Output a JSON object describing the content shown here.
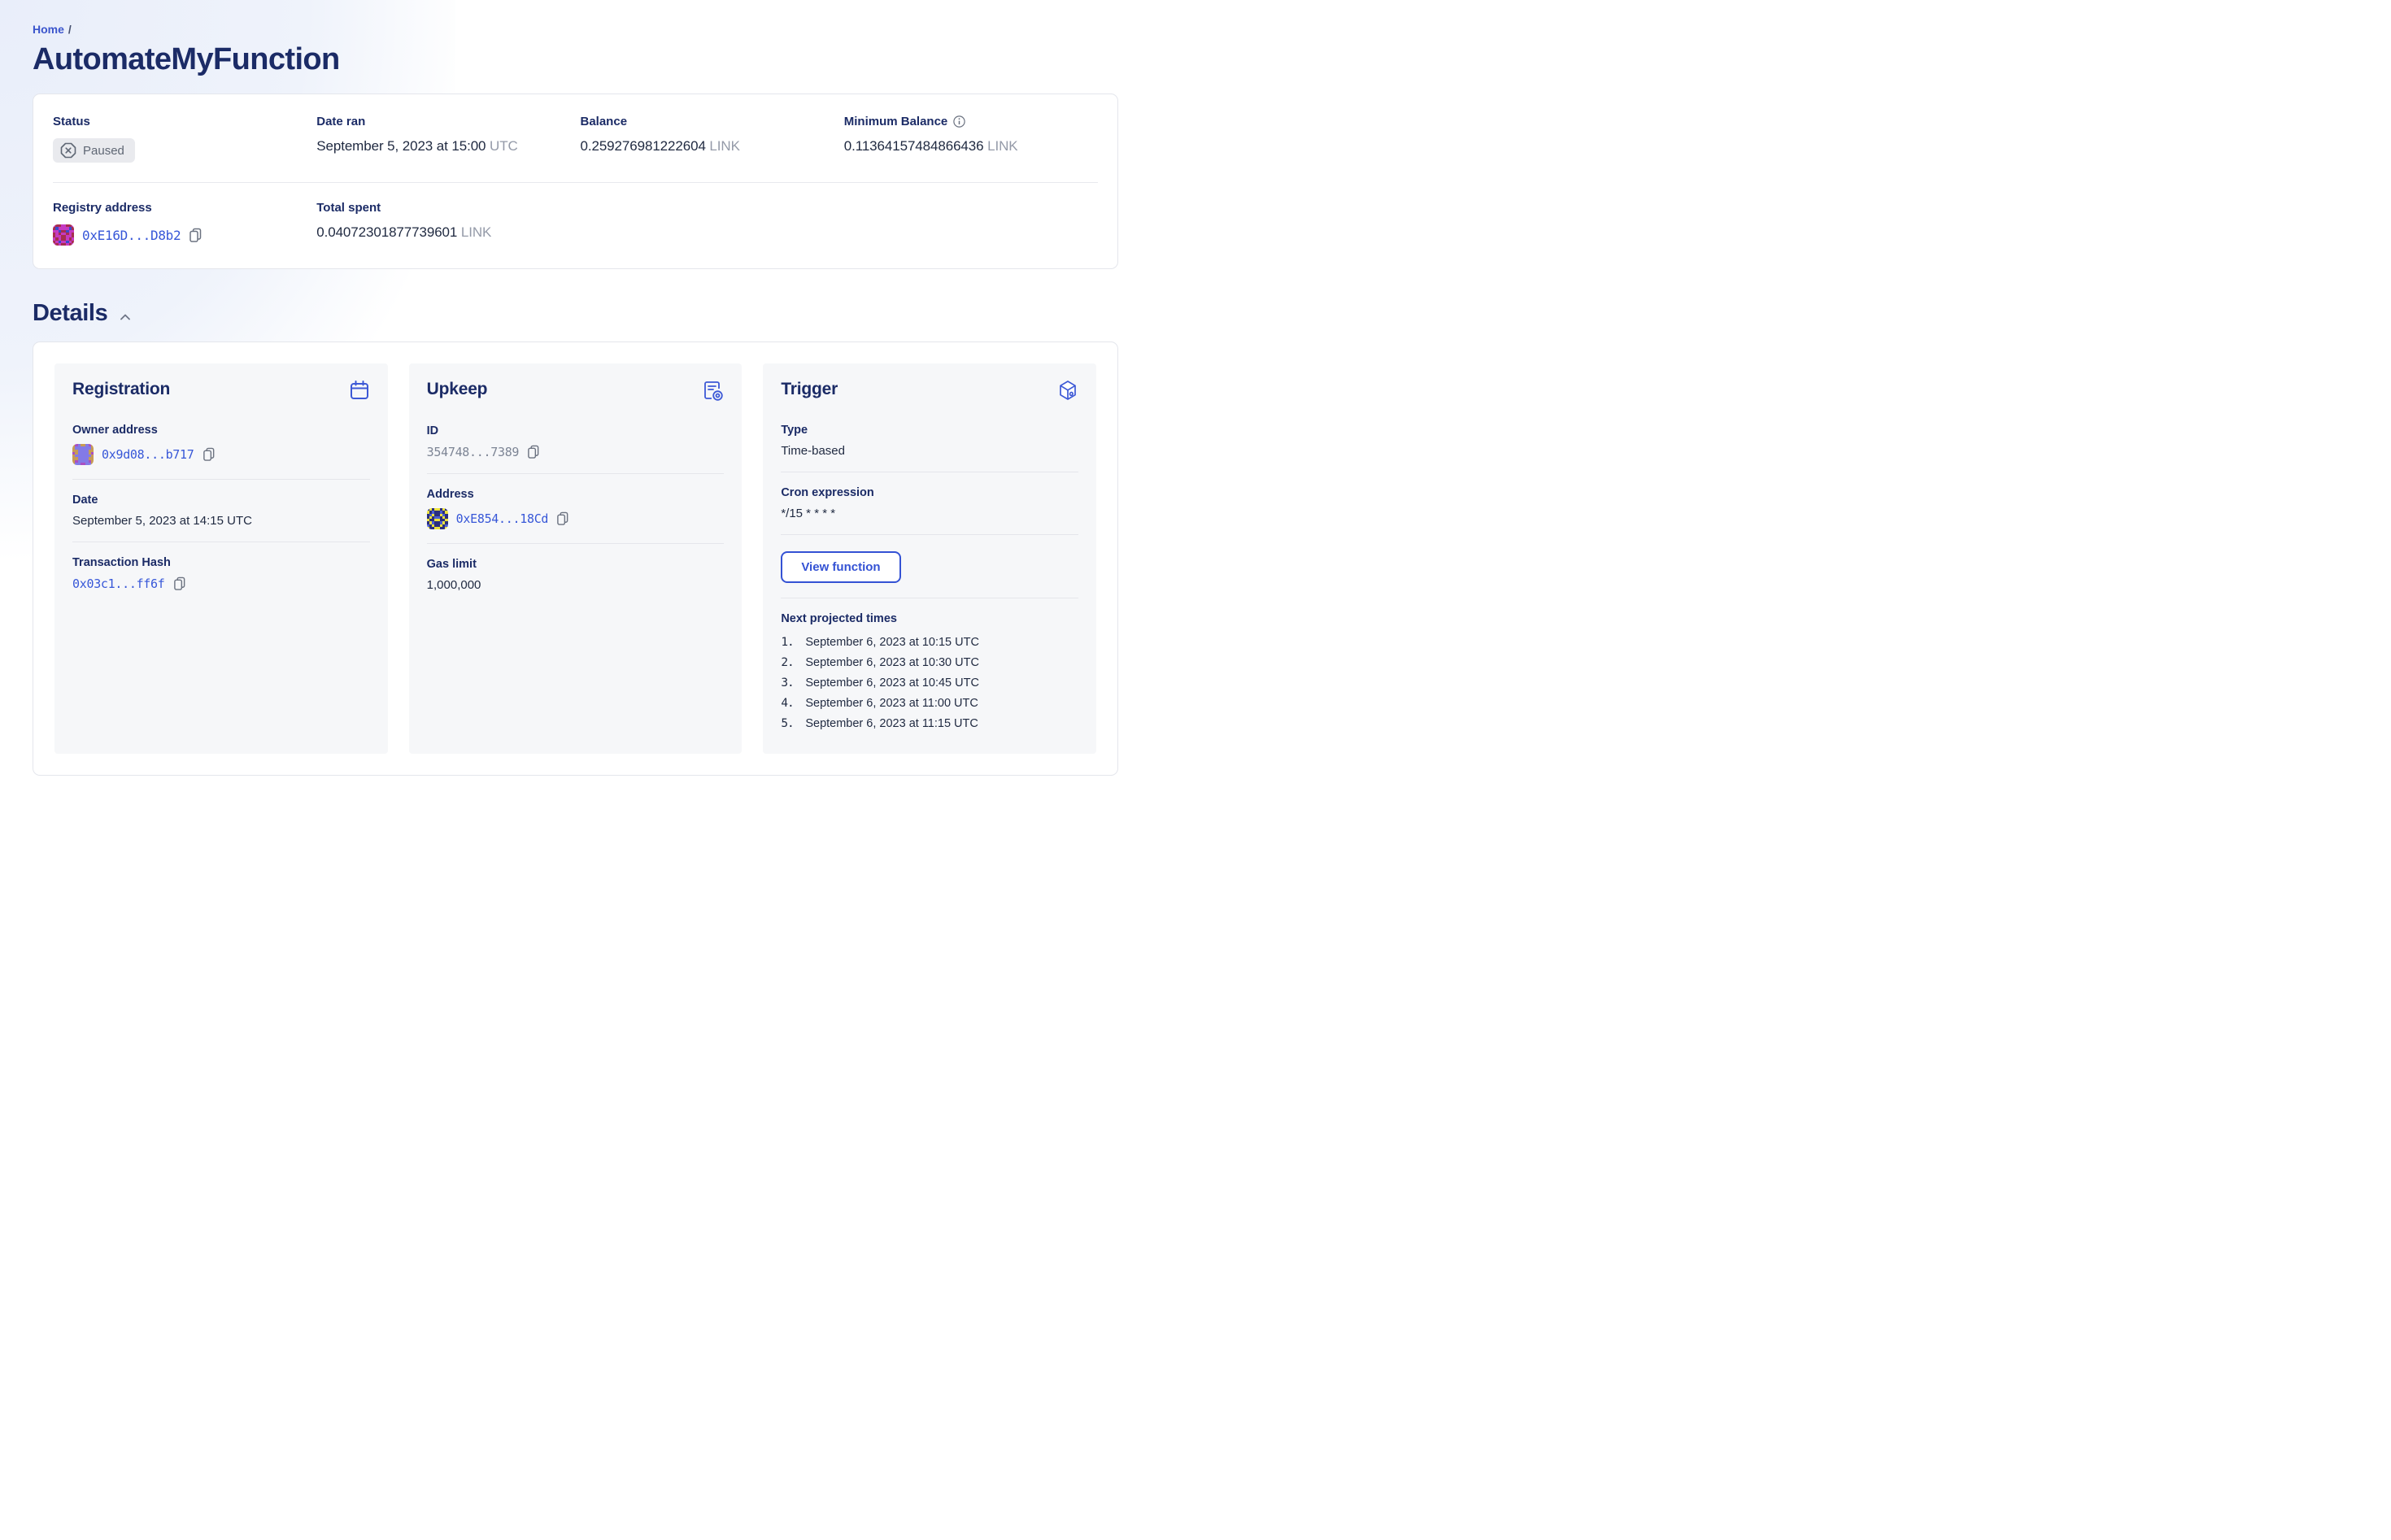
{
  "breadcrumb": {
    "home": "Home",
    "separator": "/"
  },
  "page_title": "AutomateMyFunction",
  "overview": {
    "status": {
      "label": "Status",
      "value": "Paused"
    },
    "date_ran": {
      "label": "Date ran",
      "value": "September 5, 2023 at 15:00",
      "suffix": "UTC"
    },
    "balance": {
      "label": "Balance",
      "value": "0.259276981222604",
      "suffix": "LINK"
    },
    "min_balance": {
      "label": "Minimum Balance",
      "value": "0.11364157484866436",
      "suffix": "LINK"
    },
    "registry": {
      "label": "Registry address",
      "value": "0xE16D...D8b2"
    },
    "total_spent": {
      "label": "Total spent",
      "value": "0.04072301877739601",
      "suffix": "LINK"
    }
  },
  "details": {
    "heading": "Details",
    "registration": {
      "title": "Registration",
      "owner": {
        "label": "Owner address",
        "value": "0x9d08...b717"
      },
      "date": {
        "label": "Date",
        "value": "September 5, 2023 at 14:15 UTC"
      },
      "tx": {
        "label": "Transaction Hash",
        "value": "0x03c1...ff6f"
      }
    },
    "upkeep": {
      "title": "Upkeep",
      "id": {
        "label": "ID",
        "value": "354748...7389"
      },
      "address": {
        "label": "Address",
        "value": "0xE854...18Cd"
      },
      "gas": {
        "label": "Gas limit",
        "value": "1,000,000"
      }
    },
    "trigger": {
      "title": "Trigger",
      "type": {
        "label": "Type",
        "value": "Time-based"
      },
      "cron": {
        "label": "Cron expression",
        "value": "*/15 * * * *"
      },
      "view_function_label": "View function",
      "projected": {
        "label": "Next projected times",
        "items": [
          {
            "num": "1.",
            "text": "September 6, 2023 at 10:15 UTC"
          },
          {
            "num": "2.",
            "text": "September 6, 2023 at 10:30 UTC"
          },
          {
            "num": "3.",
            "text": "September 6, 2023 at 10:45 UTC"
          },
          {
            "num": "4.",
            "text": "September 6, 2023 at 11:00 UTC"
          },
          {
            "num": "5.",
            "text": "September 6, 2023 at 11:15 UTC"
          }
        ]
      }
    }
  },
  "identicons": {
    "registry": {
      "palette": [
        "#c53ac1",
        "#a72e4e",
        "#3c49cb"
      ],
      "grid": [
        [
          0,
          1,
          1,
          0,
          0,
          1,
          1,
          0
        ],
        [
          1,
          2,
          0,
          0,
          0,
          0,
          2,
          1
        ],
        [
          0,
          0,
          2,
          1,
          1,
          2,
          0,
          0
        ],
        [
          1,
          0,
          1,
          0,
          0,
          1,
          0,
          1
        ],
        [
          1,
          0,
          0,
          1,
          1,
          0,
          0,
          1
        ],
        [
          0,
          1,
          0,
          1,
          1,
          0,
          1,
          0
        ],
        [
          1,
          0,
          2,
          0,
          0,
          2,
          0,
          1
        ],
        [
          0,
          1,
          0,
          1,
          1,
          0,
          1,
          0
        ]
      ]
    },
    "owner": {
      "palette": [
        "#c89b54",
        "#837ae6",
        "#a94fc2"
      ],
      "grid": [
        [
          0,
          2,
          1,
          0,
          0,
          1,
          2,
          0
        ],
        [
          0,
          1,
          1,
          1,
          1,
          1,
          1,
          0
        ],
        [
          0,
          0,
          1,
          1,
          1,
          1,
          0,
          0
        ],
        [
          2,
          0,
          1,
          1,
          1,
          1,
          0,
          2
        ],
        [
          0,
          1,
          1,
          1,
          1,
          1,
          1,
          0
        ],
        [
          0,
          0,
          1,
          1,
          1,
          1,
          0,
          0
        ],
        [
          0,
          2,
          1,
          1,
          1,
          1,
          2,
          0
        ],
        [
          0,
          1,
          1,
          2,
          2,
          1,
          1,
          0
        ]
      ]
    },
    "upkeep": {
      "palette": [
        "#ece23e",
        "#2b2f7e",
        "#4d5fd3"
      ],
      "grid": [
        [
          1,
          0,
          1,
          0,
          0,
          1,
          0,
          1
        ],
        [
          0,
          1,
          2,
          1,
          1,
          2,
          1,
          0
        ],
        [
          1,
          2,
          0,
          1,
          1,
          0,
          2,
          1
        ],
        [
          1,
          0,
          1,
          2,
          2,
          1,
          0,
          1
        ],
        [
          0,
          1,
          1,
          0,
          0,
          1,
          1,
          0
        ],
        [
          1,
          0,
          2,
          1,
          1,
          2,
          0,
          1
        ],
        [
          2,
          1,
          0,
          1,
          1,
          0,
          1,
          2
        ],
        [
          0,
          1,
          1,
          0,
          0,
          1,
          1,
          0
        ]
      ]
    }
  },
  "colors": {
    "accent_blue": "#3757d8",
    "heading_navy": "#1b2b66",
    "value_dark": "#1f2940",
    "muted_gray": "#949aa8",
    "badge_bg": "#e9eaee",
    "badge_text": "#5f6774",
    "card_bg": "#f6f7f9",
    "border": "#e4e6ec",
    "decor_blue": "#e9eefa"
  }
}
